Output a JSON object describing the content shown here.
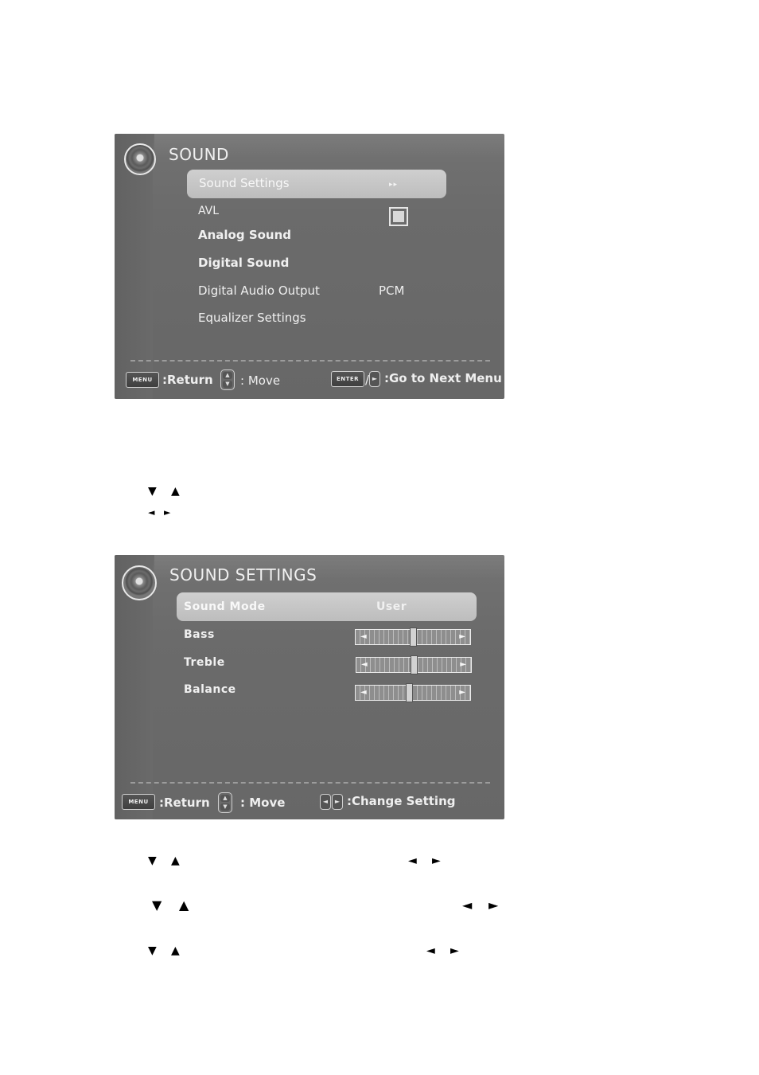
{
  "sound_menu": {
    "title": "SOUND",
    "items": [
      {
        "label": "Sound Settings",
        "value": "▸▸",
        "selected": true
      },
      {
        "label": "AVL",
        "control": "checkbox",
        "checked": false
      },
      {
        "label": "Analog Sound",
        "value": ""
      },
      {
        "label": "Digital Sound",
        "value": ""
      },
      {
        "label": "Digital Audio Output",
        "value": "PCM"
      },
      {
        "label": "Equalizer Settings",
        "value": ""
      }
    ],
    "footer": {
      "menu_key": "MENU",
      "return_label": ":Return",
      "move_label": ": Move",
      "enter_key": "ENTER",
      "slash": "/",
      "next_label": ":Go to Next Menu"
    }
  },
  "instruction_arrows_1": {
    "updown": [
      "▼",
      "▲"
    ],
    "leftright": [
      "◄",
      "►"
    ]
  },
  "sound_settings_menu": {
    "title": "SOUND SETTINGS",
    "items": [
      {
        "label": "Sound Mode",
        "value": "User",
        "selected": true
      },
      {
        "label": "Bass",
        "control": "slider",
        "level_percent": 50
      },
      {
        "label": "Treble",
        "control": "slider",
        "level_percent": 50
      },
      {
        "label": "Balance",
        "control": "slider",
        "level_percent": 47
      }
    ],
    "footer": {
      "menu_key": "MENU",
      "return_label": ":Return",
      "move_label": ": Move",
      "change_label": ":Change Setting"
    }
  },
  "instruction_arrows_2": [
    {
      "updown": [
        "▼",
        "▲"
      ],
      "leftright": [
        "◄",
        "►"
      ]
    },
    {
      "updown": [
        "▼",
        "▲"
      ],
      "leftright": [
        "◄",
        "►"
      ]
    },
    {
      "updown": [
        "▼",
        "▲"
      ],
      "leftright": [
        "◄",
        "►"
      ]
    }
  ],
  "icons": {
    "speaker": "speaker-icon",
    "arrow_left": "◄",
    "arrow_right": "►",
    "arrow_up": "▲",
    "arrow_down": "▼"
  }
}
